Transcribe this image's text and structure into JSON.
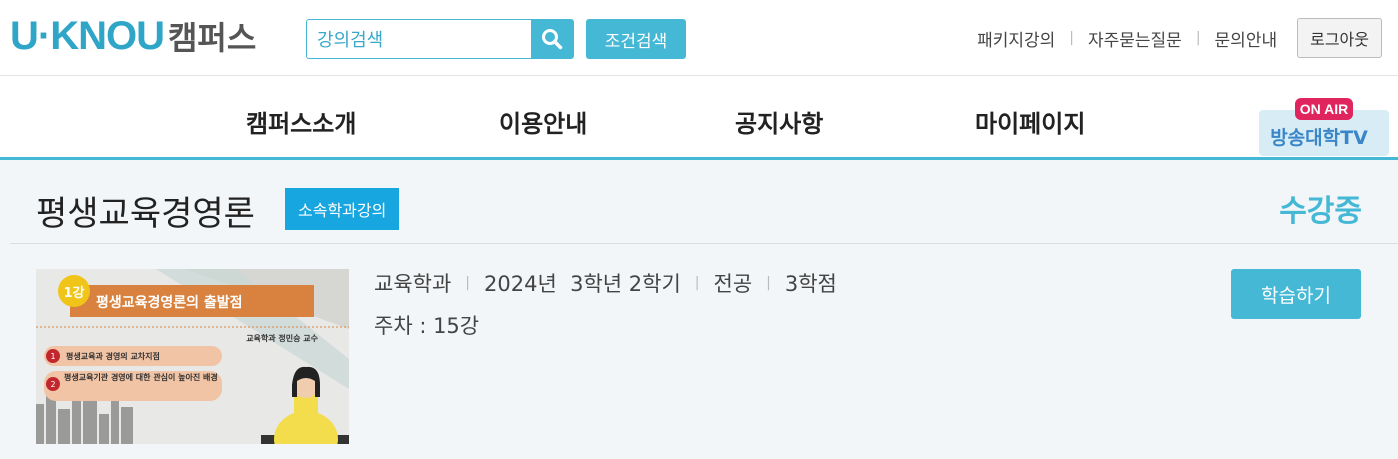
{
  "header": {
    "logo_main": "U·KNOU",
    "logo_sub": "캠퍼스",
    "search": {
      "placeholder": "강의검색",
      "value": "강의검색"
    },
    "cond_search_label": "조건검색",
    "util_links": [
      "패키지강의",
      "자주묻는질문",
      "문의안내"
    ],
    "logout_label": "로그아웃"
  },
  "nav": {
    "items": [
      "캠퍼스소개",
      "이용안내",
      "공지사항",
      "마이페이지"
    ],
    "onair_badge": "ON AIR",
    "onair_label": "방송대학TV"
  },
  "course": {
    "title": "평생교육경영론",
    "badge": "소속학과강의",
    "status": "수강중",
    "department": "교육학과",
    "term": "2024년  3학년 2학기",
    "type": "전공",
    "credits": "3학점",
    "weeks": "주차 : 15강",
    "study_button": "학습하기",
    "thumbnail": {
      "lecture_no": "1강",
      "heading": "평생교육경영론의 출발점",
      "professor": "교육학과 정민승 교수",
      "points": [
        "평생교육과 경영의 교차지점",
        "평생교육기관 경영에 대한 관심이 높아진 배경"
      ]
    }
  },
  "colors": {
    "accent": "#45b8d6",
    "badge": "#18a6e0",
    "thumb_orange": "#d9823f"
  }
}
